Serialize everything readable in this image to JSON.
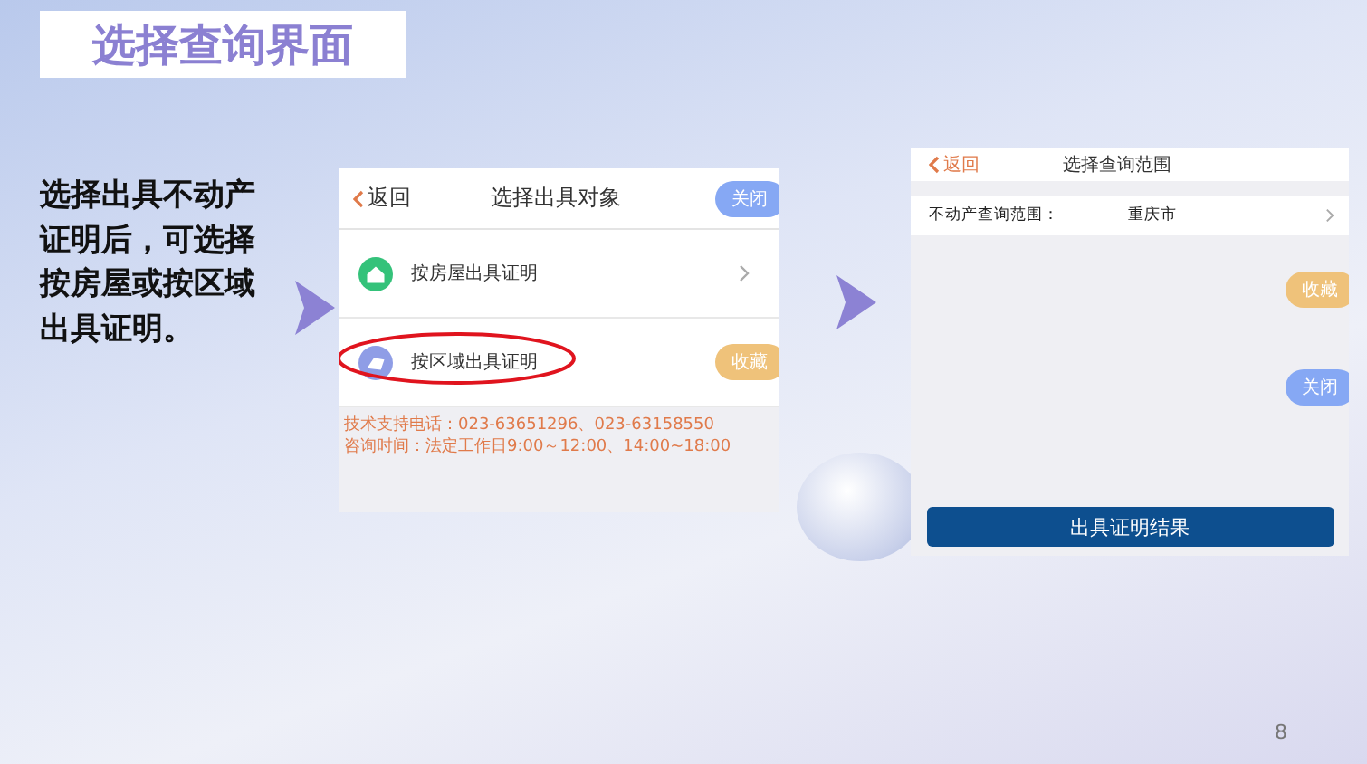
{
  "slide": {
    "title": "选择查询界面",
    "description": "选择出具不动产证明后，可选择按房屋或按区域出具证明。",
    "page_number": "8"
  },
  "screen_1": {
    "back": "返回",
    "title": "选择出具对象",
    "close": "关闭",
    "favorite": "收藏",
    "items": [
      {
        "label": "按房屋出具证明",
        "kind": "house",
        "highlighted": false
      },
      {
        "label": "按区域出具证明",
        "kind": "area",
        "highlighted": true
      }
    ],
    "info": [
      "技术支持电话：023-63651296、023-63158550",
      "咨询时间：法定工作日9:00～12:00、14:00~18:00"
    ]
  },
  "screen_2": {
    "back": "返回",
    "title": "选择查询范围",
    "field_label": "不动产查询范围：",
    "field_value": "重庆市",
    "favorite": "收藏",
    "close": "关闭",
    "submit": "出具证明结果"
  }
}
